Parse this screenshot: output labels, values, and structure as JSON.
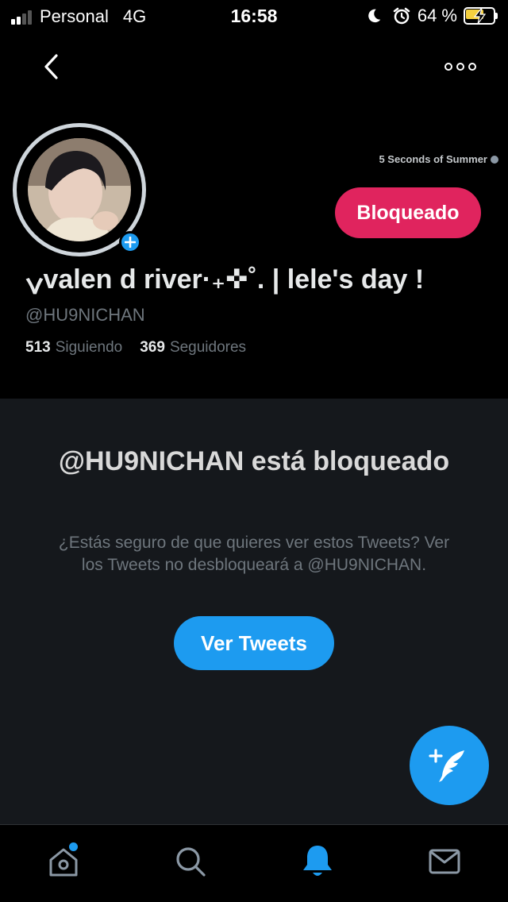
{
  "status_bar": {
    "carrier": "Personal",
    "network": "4G",
    "time": "16:58",
    "battery_percent": "64 %",
    "icons": [
      "signal-icon",
      "moon-icon",
      "alarm-icon",
      "battery-charging-icon"
    ]
  },
  "nav": {
    "back_icon": "chevron-left-icon",
    "more_icon": "more-options-icon"
  },
  "profile": {
    "header_note": "5 Seconds of Summer",
    "display_name": "ݍvalen d river·₊✜˚. | lele's day !",
    "handle": "@HU9NICHAN",
    "following_count": "513",
    "following_label": "Siguiendo",
    "followers_count": "369",
    "followers_label": "Seguidores",
    "blocked_button_label": "Bloqueado"
  },
  "blocked_notice": {
    "title": "@HU9NICHAN está bloqueado",
    "body": "¿Estás seguro de que quieres ver estos Tweets? Ver los Tweets no desbloqueará a @HU9NICHAN.",
    "button_label": "Ver Tweets"
  },
  "compose": {
    "icon": "compose-tweet-icon"
  },
  "tab_bar": {
    "tabs": [
      {
        "icon": "home-icon",
        "active": false,
        "has_dot": true
      },
      {
        "icon": "search-icon",
        "active": false,
        "has_dot": false
      },
      {
        "icon": "bell-icon",
        "active": true,
        "has_dot": false
      },
      {
        "icon": "mail-icon",
        "active": false,
        "has_dot": false
      }
    ]
  },
  "colors": {
    "accent": "#1d9bf0",
    "blocked": "#e0245e",
    "background": "#000000",
    "panel": "#15181c",
    "muted_text": "#6e767d"
  }
}
